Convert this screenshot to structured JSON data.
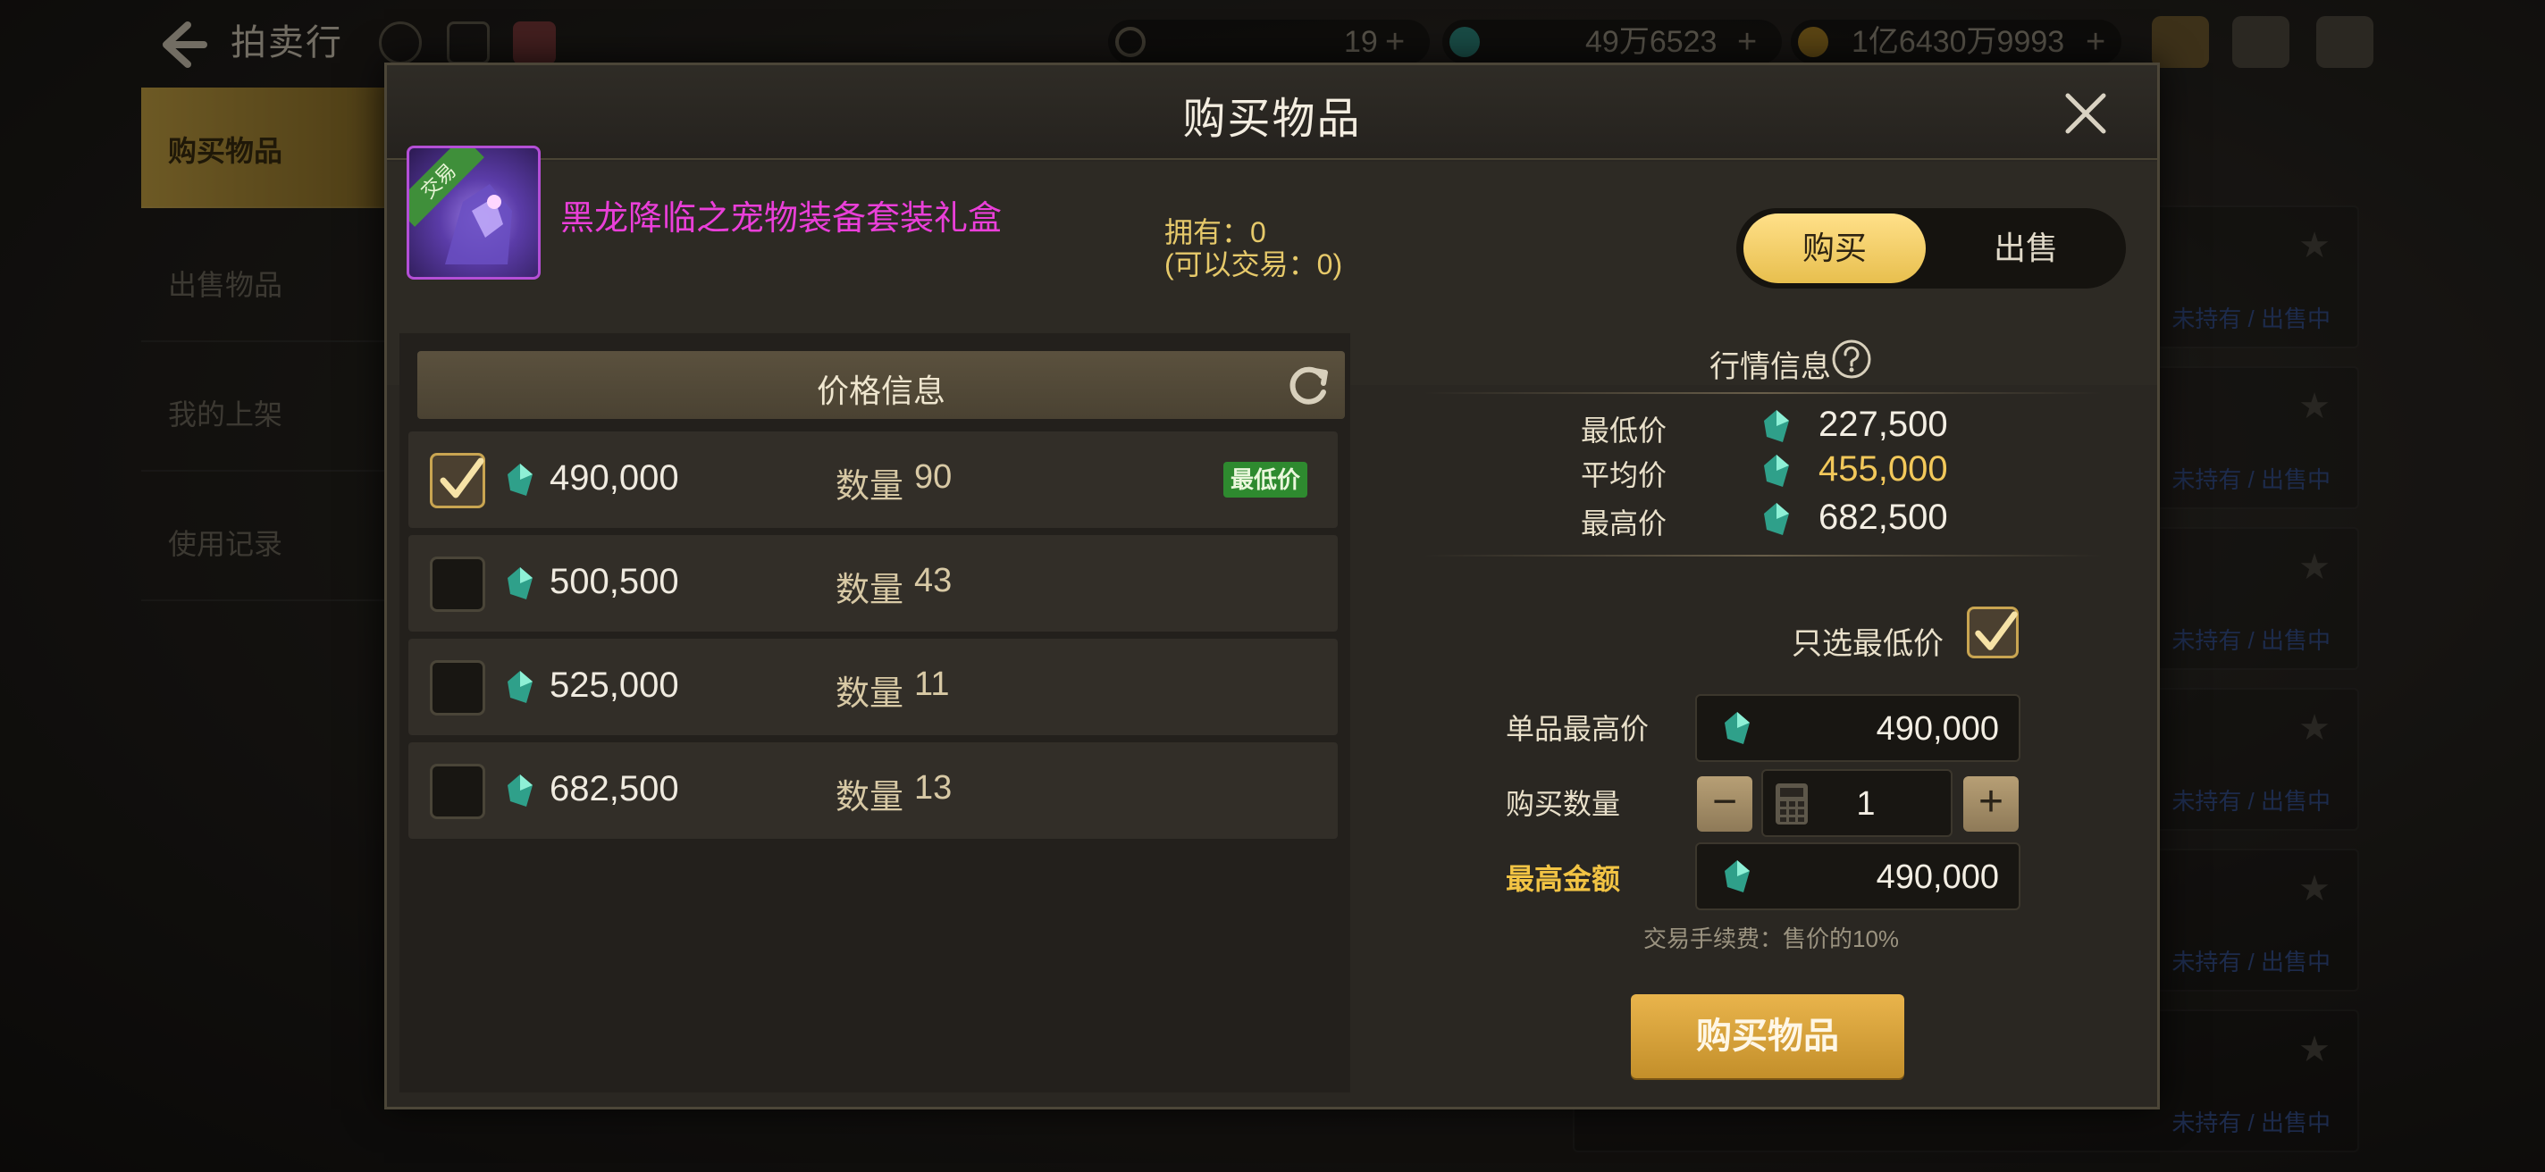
{
  "header": {
    "title": "拍卖行",
    "resource_1": "19",
    "resource_2": "49万6523",
    "resource_3": "1亿6430万9993",
    "plus": "+"
  },
  "sidebar": {
    "items": [
      {
        "label": "购买物品"
      },
      {
        "label": "出售物品"
      },
      {
        "label": "我的上架"
      },
      {
        "label": "使用记录"
      }
    ]
  },
  "background_list": {
    "tag": "未持有 / 出售中"
  },
  "modal": {
    "title": "购买物品",
    "item": {
      "ribbon": "交易",
      "name": "黑龙降临之宠物装备套装礼盒",
      "owned": "拥有：0",
      "tradeable": "(可以交易：0)"
    },
    "toggle": {
      "buy": "购买",
      "sell": "出售"
    },
    "price_panel": {
      "header": "价格信息",
      "qty_label": "数量",
      "lowest_badge": "最低价",
      "rows": [
        {
          "price": "490,000",
          "qty": "90",
          "checked": true,
          "lowest": true
        },
        {
          "price": "500,500",
          "qty": "43",
          "checked": false,
          "lowest": false
        },
        {
          "price": "525,000",
          "qty": "11",
          "checked": false,
          "lowest": false
        },
        {
          "price": "682,500",
          "qty": "13",
          "checked": false,
          "lowest": false
        }
      ]
    },
    "market": {
      "title": "行情信息",
      "lowest_label": "最低价",
      "lowest_value": "227,500",
      "average_label": "平均价",
      "average_value": "455,000",
      "highest_label": "最高价",
      "highest_value": "682,500"
    },
    "form": {
      "only_lowest_label": "只选最低价",
      "only_lowest_checked": true,
      "unit_max_label": "单品最高价",
      "unit_max_value": "490,000",
      "quantity_label": "购买数量",
      "quantity_value": "1",
      "minus": "−",
      "plus": "+",
      "max_total_label": "最高金额",
      "max_total_value": "490,000",
      "fee_note": "交易手续费：售价的10%"
    },
    "buy_button": "购买物品"
  },
  "colors": {
    "accent_gold": "#e9b44c",
    "item_name": "#ea3fd9",
    "badge_green": "#2e8a2f",
    "average_price": "#f2c85a"
  }
}
